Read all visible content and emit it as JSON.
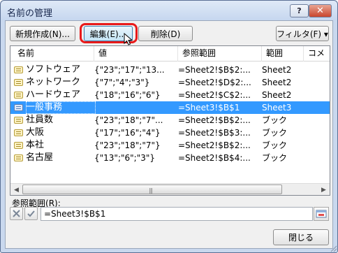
{
  "window": {
    "title": "名前の管理",
    "help_label": "?",
    "close_label": "✕"
  },
  "toolbar": {
    "new_label": "新規作成(N)...",
    "edit_label": "編集(E)...",
    "delete_label": "削除(D)",
    "filter_label": "フィルタ(F) ▾"
  },
  "list": {
    "columns": [
      "名前",
      "値",
      "参照範囲",
      "範囲",
      "コメ"
    ],
    "rows": [
      {
        "name": "ソフトウェア",
        "value": "{\"23\";\"17\";\"13...",
        "ref": "=Sheet2!$B$2:...",
        "scope": "Sheet2",
        "selected": false
      },
      {
        "name": "ネットワーク",
        "value": "{\"7\";\"4\";\"3\"}",
        "ref": "=Sheet2!$D$2:...",
        "scope": "Sheet2",
        "selected": false
      },
      {
        "name": "ハードウェア",
        "value": "{\"18\";\"16\";\"6\"}",
        "ref": "=Sheet2!$C$2:...",
        "scope": "Sheet2",
        "selected": false
      },
      {
        "name": "一般事務",
        "value": "",
        "ref": "=Sheet3!$B$1",
        "scope": "Sheet3",
        "selected": true
      },
      {
        "name": "社員数",
        "value": "{\"23\";\"18\";\"7\"...",
        "ref": "=Sheet2!$B$2:...",
        "scope": "ブック",
        "selected": false
      },
      {
        "name": "大阪",
        "value": "{\"17\";\"16\";\"4\"}",
        "ref": "=Sheet2!$B$3:...",
        "scope": "ブック",
        "selected": false
      },
      {
        "name": "本社",
        "value": "{\"23\";\"18\";\"7\"}",
        "ref": "=Sheet2!$B$2:...",
        "scope": "ブック",
        "selected": false
      },
      {
        "name": "名古屋",
        "value": "{\"13\";\"6\";\"3\"}",
        "ref": "=Sheet2!$B$4:...",
        "scope": "ブック",
        "selected": false
      }
    ]
  },
  "reference": {
    "label": "参照範囲",
    "label_key": "R",
    "value": "=Sheet3!$B$1"
  },
  "footer": {
    "close_label": "閉じる"
  },
  "colors": {
    "selection": "#3399ff",
    "highlight_ring": "#e81a1a",
    "title_bar": "#c6d7ef"
  },
  "icons": [
    "name-icon",
    "cursor-icon",
    "cancel-x-icon",
    "check-icon",
    "range-collapse-icon"
  ]
}
